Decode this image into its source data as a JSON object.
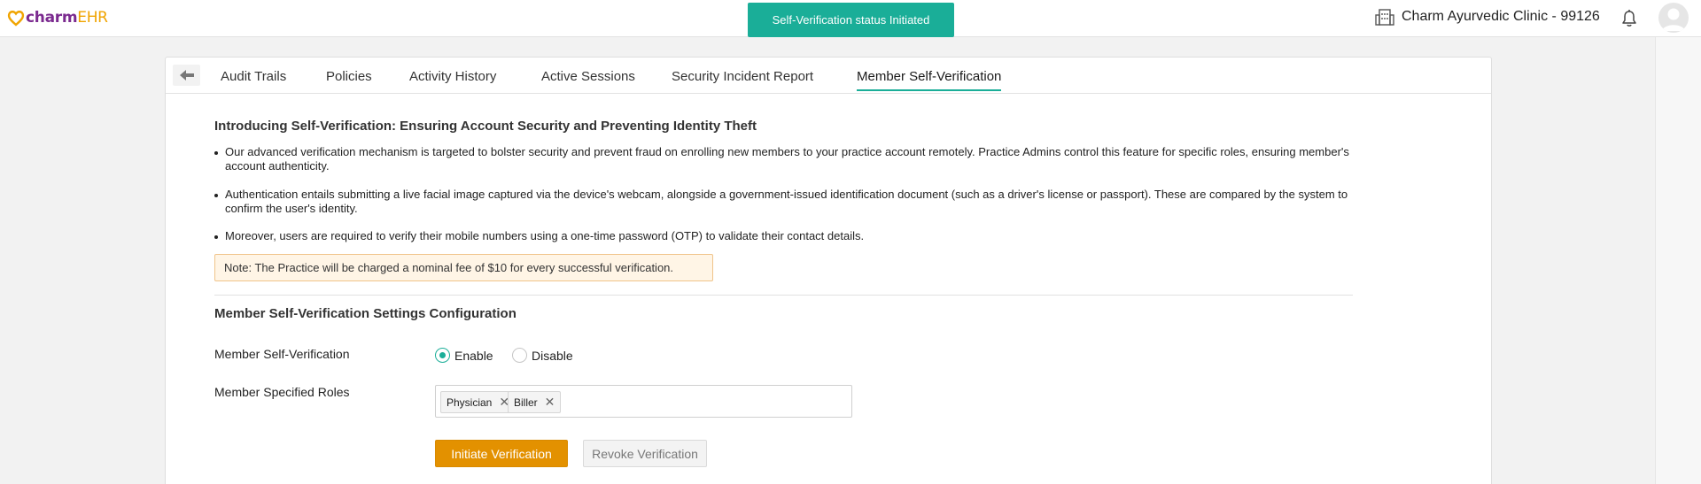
{
  "app": {
    "logo_charm": "charm",
    "logo_ehr": "EHR"
  },
  "toast": {
    "message": "Self-Verification status Initiated"
  },
  "header": {
    "clinic_name": "Charm Ayurvedic Clinic - 99126"
  },
  "tabs": [
    {
      "label": "Audit Trails"
    },
    {
      "label": "Policies"
    },
    {
      "label": "Activity History"
    },
    {
      "label": "Active Sessions"
    },
    {
      "label": "Security Incident Report"
    },
    {
      "label": "Member Self-Verification",
      "active": true
    }
  ],
  "intro": {
    "title": "Introducing Self-Verification: Ensuring Account Security and Preventing Identity Theft",
    "bullets": [
      "Our advanced verification mechanism is targeted to bolster security and prevent fraud on enrolling new members to your practice account remotely. Practice Admins control this feature for specific roles, ensuring member's account authenticity.",
      "Authentication entails submitting a live facial image captured via the device's webcam, alongside a government-issued identification document (such as a driver's license or passport). These are compared by the system to confirm the user's identity.",
      "Moreover, users are required to verify their mobile numbers using a one-time password (OTP) to validate their contact details."
    ],
    "note": "Note: The Practice will be charged a nominal fee of $10 for every successful verification."
  },
  "settings": {
    "title": "Member Self-Verification Settings Configuration",
    "verification_label": "Member Self-Verification",
    "enable_label": "Enable",
    "disable_label": "Disable",
    "selected": "Enable",
    "roles_label": "Member Specified Roles",
    "roles": [
      "Physician",
      "Biller"
    ],
    "remove_glyph": "✕",
    "initiate_button": "Initiate Verification",
    "revoke_button": "Revoke Verification"
  },
  "colors": {
    "accent": "#1aae98",
    "primary_button": "#e39100",
    "brand_purple": "#7b2a8f",
    "brand_orange": "#f0a400"
  }
}
